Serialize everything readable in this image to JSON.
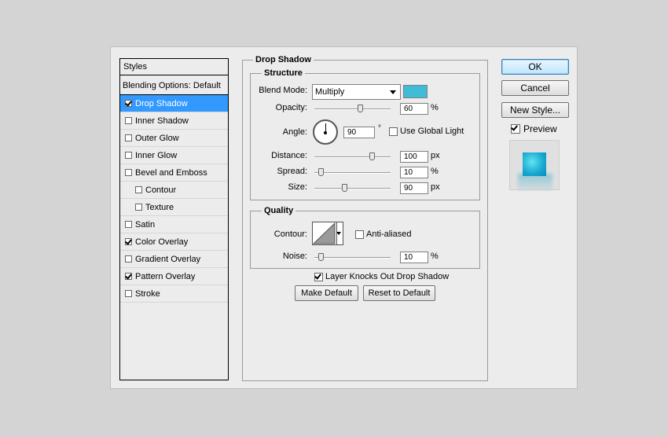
{
  "styles_panel": {
    "header": "Styles",
    "blending_options": "Blending Options: Default",
    "items": [
      {
        "label": "Drop Shadow",
        "checked": true,
        "selected": true,
        "sub": false
      },
      {
        "label": "Inner Shadow",
        "checked": false,
        "selected": false,
        "sub": false
      },
      {
        "label": "Outer Glow",
        "checked": false,
        "selected": false,
        "sub": false
      },
      {
        "label": "Inner Glow",
        "checked": false,
        "selected": false,
        "sub": false
      },
      {
        "label": "Bevel and Emboss",
        "checked": false,
        "selected": false,
        "sub": false
      },
      {
        "label": "Contour",
        "checked": false,
        "selected": false,
        "sub": true
      },
      {
        "label": "Texture",
        "checked": false,
        "selected": false,
        "sub": true
      },
      {
        "label": "Satin",
        "checked": false,
        "selected": false,
        "sub": false
      },
      {
        "label": "Color Overlay",
        "checked": true,
        "selected": false,
        "sub": false
      },
      {
        "label": "Gradient Overlay",
        "checked": false,
        "selected": false,
        "sub": false
      },
      {
        "label": "Pattern Overlay",
        "checked": true,
        "selected": false,
        "sub": false
      },
      {
        "label": "Stroke",
        "checked": false,
        "selected": false,
        "sub": false
      }
    ]
  },
  "drop_shadow": {
    "title": "Drop Shadow",
    "structure": {
      "title": "Structure",
      "blend_mode_label": "Blend Mode:",
      "blend_mode_value": "Multiply",
      "shadow_color": "#40bcd6",
      "opacity_label": "Opacity:",
      "opacity_value": "60",
      "opacity_unit": "%",
      "angle_label": "Angle:",
      "angle_value": "90",
      "angle_unit": "°",
      "use_global_light_label": "Use Global Light",
      "use_global_light_checked": false,
      "distance_label": "Distance:",
      "distance_value": "100",
      "distance_unit": "px",
      "spread_label": "Spread:",
      "spread_value": "10",
      "spread_unit": "%",
      "size_label": "Size:",
      "size_value": "90",
      "size_unit": "px"
    },
    "quality": {
      "title": "Quality",
      "contour_label": "Contour:",
      "anti_aliased_label": "Anti-aliased",
      "anti_aliased_checked": false,
      "noise_label": "Noise:",
      "noise_value": "10",
      "noise_unit": "%"
    },
    "layer_knocks_out_label": "Layer Knocks Out Drop Shadow",
    "layer_knocks_out_checked": true,
    "make_default_label": "Make Default",
    "reset_default_label": "Reset to Default"
  },
  "buttons": {
    "ok": "OK",
    "cancel": "Cancel",
    "new_style": "New Style..."
  },
  "preview": {
    "label": "Preview",
    "checked": true
  }
}
